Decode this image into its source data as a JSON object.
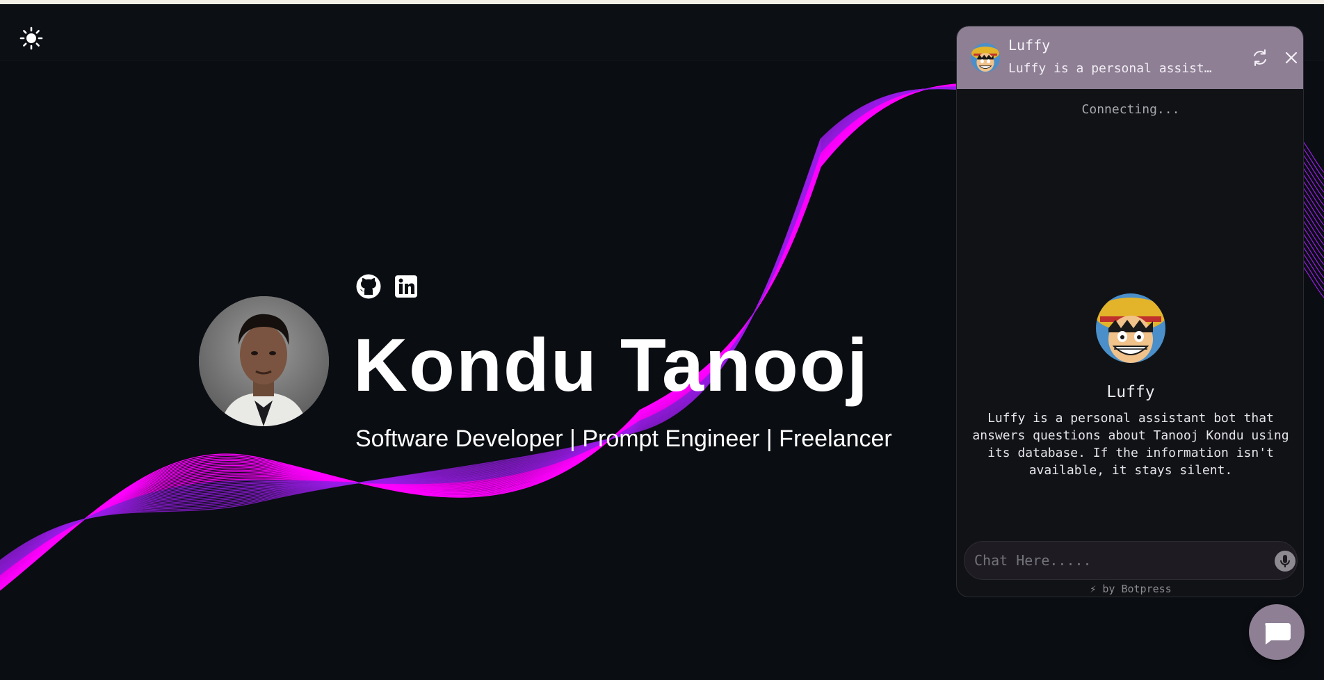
{
  "navbar": {
    "theme_toggle_icon": "sun-icon"
  },
  "hero": {
    "name": "Kondu Tanooj",
    "subtitle": "Software Developer | Prompt Engineer | Freelancer",
    "social_icons": [
      "github-icon",
      "linkedin-icon"
    ],
    "wave_colors": [
      "#ff00ff",
      "#9a1ce8"
    ]
  },
  "chat": {
    "title": "Luffy",
    "description": "Luffy is a personal assistant bot that answers questions about Tanooj Kondu using its database. If the information isn't available, it stays silent.",
    "status": "Connecting...",
    "bot_name": "Luffy",
    "about": "Luffy is a personal assistant bot that answers questions about Tanooj Kondu using its database. If the information isn't available, it stays silent.",
    "input_placeholder": "Chat Here.....",
    "footer": "⚡ by Botpress",
    "header_color": "#8e7f95",
    "header_buttons": [
      "refresh-icon",
      "close-icon"
    ]
  },
  "launcher": {
    "icon": "chat-bubble-icon"
  }
}
